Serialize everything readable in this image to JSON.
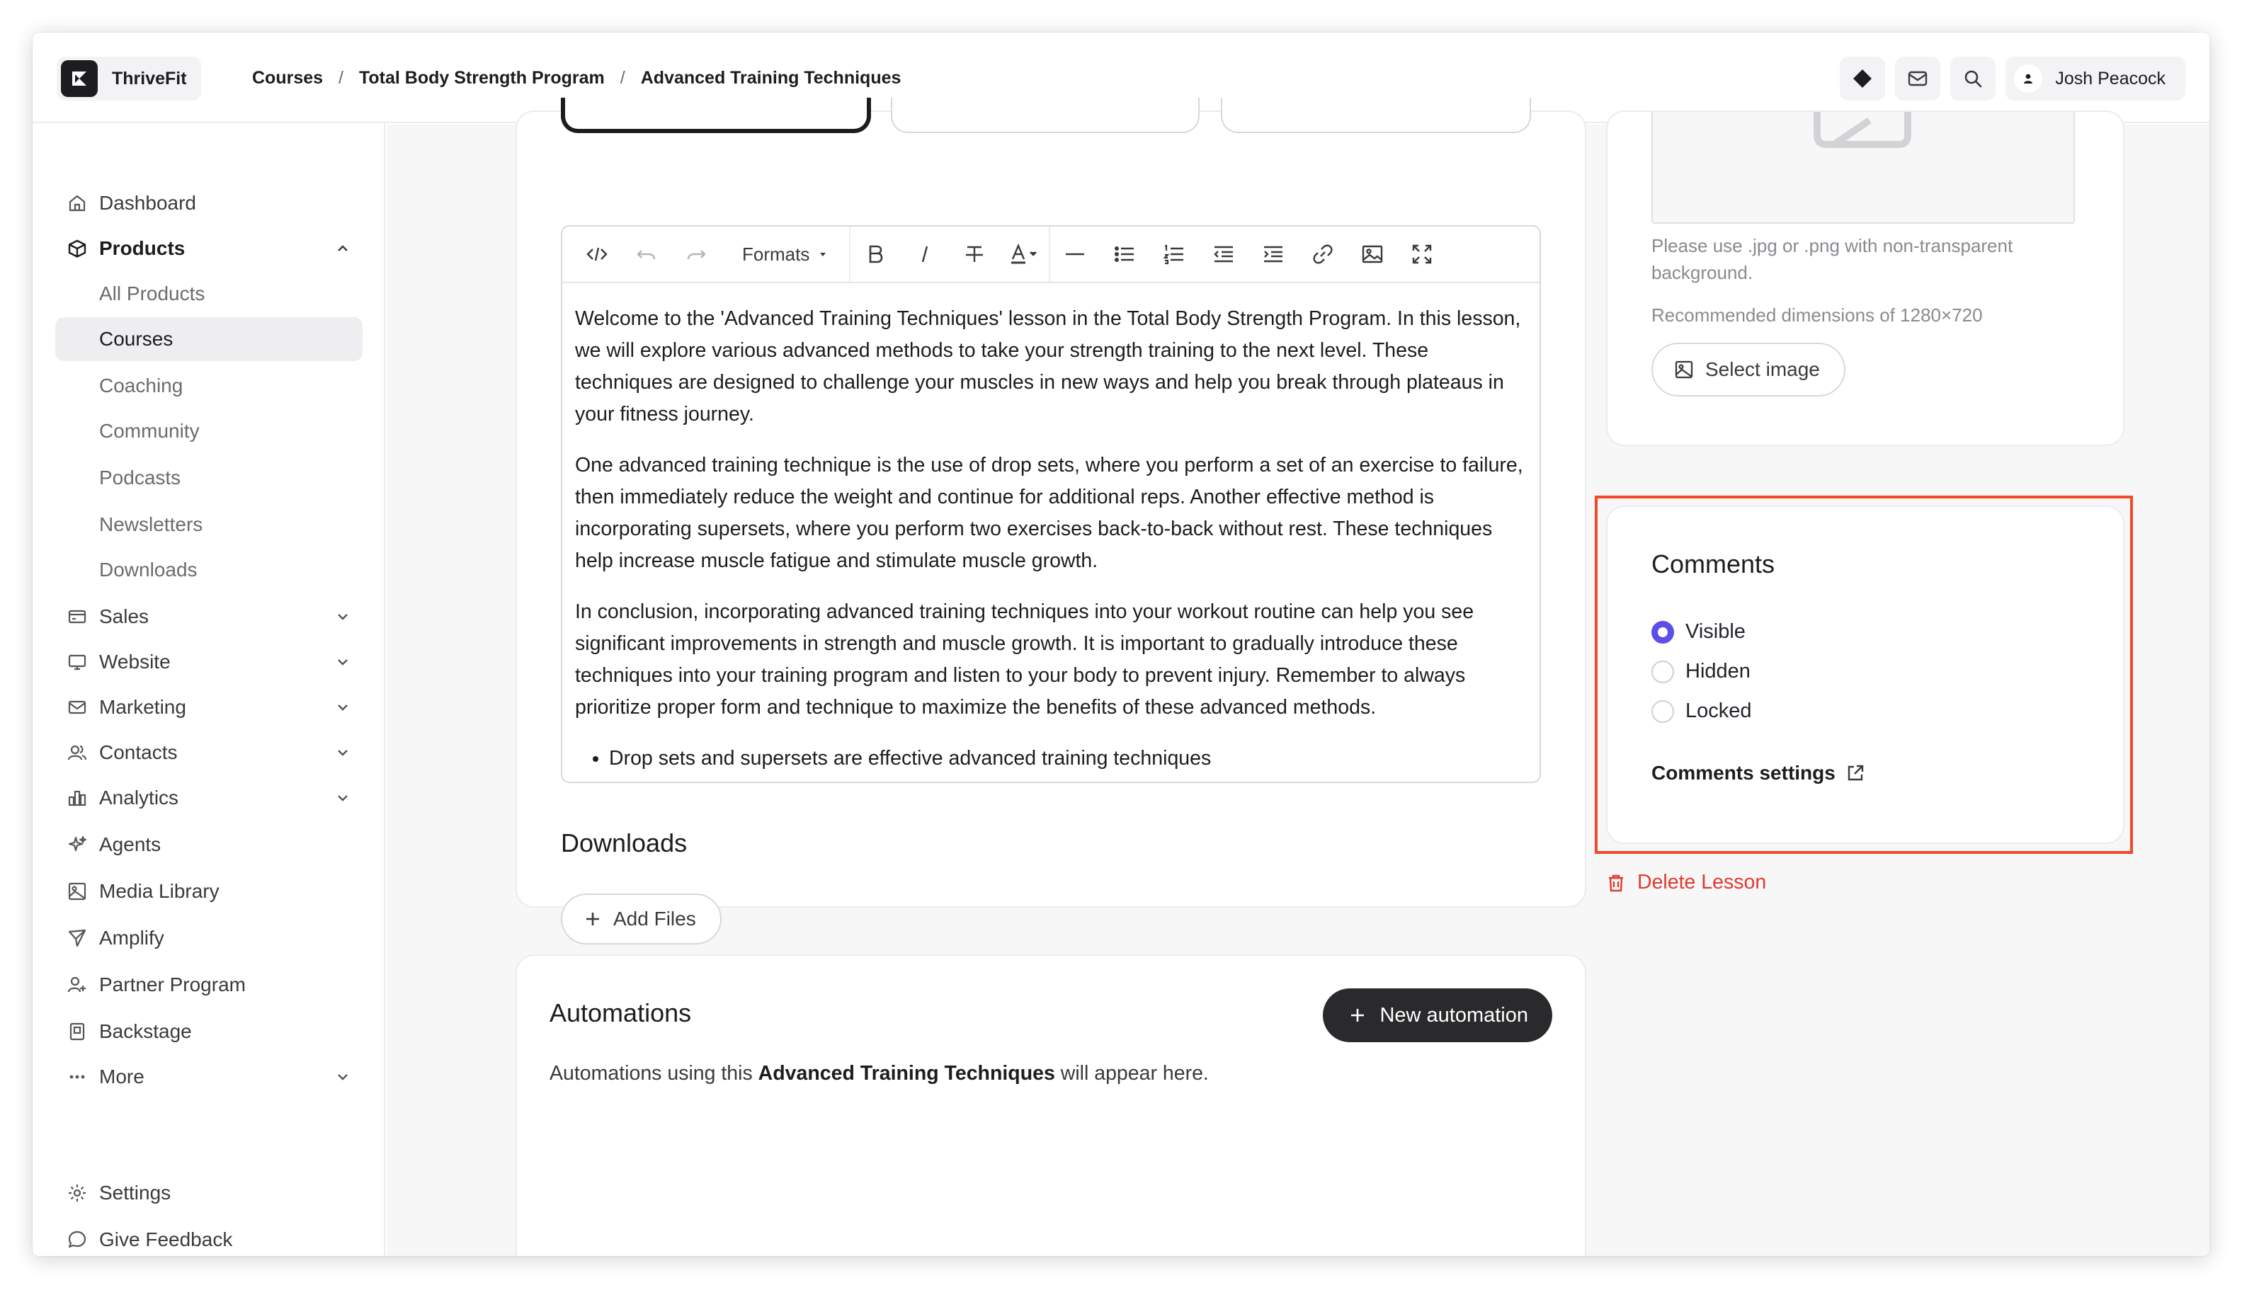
{
  "app": {
    "name": "ThriveFit"
  },
  "breadcrumbs": [
    "Courses",
    "Total Body Strength Program",
    "Advanced Training Techniques"
  ],
  "user": {
    "name": "Josh Peacock"
  },
  "sidebar": {
    "dashboard": "Dashboard",
    "products": "Products",
    "product_items": [
      "All Products",
      "Courses",
      "Coaching",
      "Community",
      "Podcasts",
      "Newsletters",
      "Downloads"
    ],
    "active_item": "Courses",
    "sections": [
      "Sales",
      "Website",
      "Marketing",
      "Contacts",
      "Analytics"
    ],
    "agents": "Agents",
    "media_library": "Media Library",
    "amplify": "Amplify",
    "partner_program": "Partner Program",
    "backstage": "Backstage",
    "more": "More",
    "settings": "Settings",
    "give_feedback": "Give Feedback"
  },
  "editor": {
    "formats_label": "Formats",
    "paragraphs": [
      "Welcome to the 'Advanced Training Techniques' lesson in the Total Body Strength Program. In this lesson, we will explore various advanced methods to take your strength training to the next level. These techniques are designed to challenge your muscles in new ways and help you break through plateaus in your fitness journey.",
      "One advanced training technique is the use of drop sets, where you perform a set of an exercise to failure, then immediately reduce the weight and continue for additional reps. Another effective method is incorporating supersets, where you perform two exercises back-to-back without rest. These techniques help increase muscle fatigue and stimulate muscle growth.",
      "In conclusion, incorporating advanced training techniques into your workout routine can help you see significant improvements in strength and muscle growth. It is important to gradually introduce these techniques into your training program and listen to your body to prevent injury. Remember to always prioritize proper form and technique to maximize the benefits of these advanced methods."
    ],
    "bullets": [
      "Drop sets and supersets are effective advanced training techniques"
    ]
  },
  "downloads": {
    "title": "Downloads",
    "add_files": "Add Files"
  },
  "automations": {
    "title": "Automations",
    "new_button": "New automation",
    "desc_prefix": "Automations using this ",
    "desc_bold": "Advanced Training Techniques",
    "desc_suffix": " will appear here."
  },
  "image_panel": {
    "hint": "Please use .jpg or .png with non-transparent background.",
    "dimensions": "Recommended dimensions of 1280×720",
    "select_button": "Select image"
  },
  "comments": {
    "title": "Comments",
    "options": [
      "Visible",
      "Hidden",
      "Locked"
    ],
    "selected": "Visible",
    "settings_link": "Comments settings"
  },
  "delete_lesson": "Delete Lesson",
  "colors": {
    "accent": "#5b4fe8",
    "danger": "#e03a2f",
    "highlight": "#f04a2a",
    "dark_button": "#2a2a2d"
  }
}
